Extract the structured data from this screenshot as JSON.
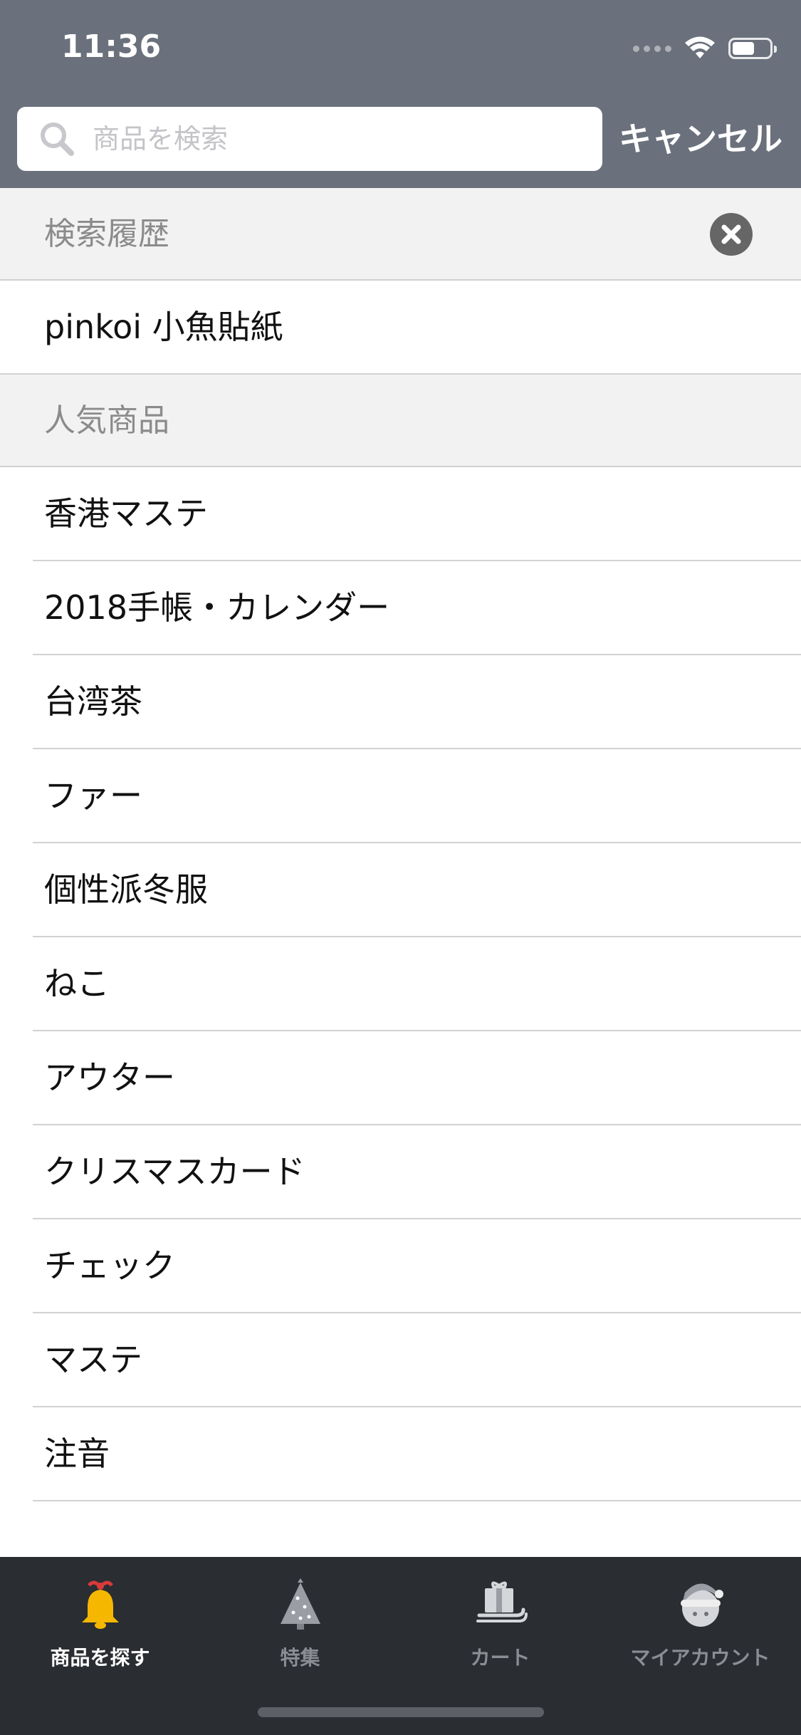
{
  "status_bar": {
    "time": "11:36",
    "battery_level": 0.6
  },
  "search": {
    "placeholder": "商品を検索",
    "value": "",
    "cancel_label": "キャンセル"
  },
  "history": {
    "title": "検索履歴",
    "items": [
      "pinkoi 小魚貼紙"
    ]
  },
  "popular": {
    "title": "人気商品",
    "items": [
      "香港マステ",
      "2018手帳・カレンダー",
      "台湾茶",
      "ファー",
      "個性派冬服",
      "ねこ",
      "アウター",
      "クリスマスカード",
      "チェック",
      "マステ",
      "注音"
    ]
  },
  "tabbar": {
    "tabs": [
      {
        "label": "商品を探す",
        "icon": "bell-icon",
        "active": true
      },
      {
        "label": "特集",
        "icon": "christmas-tree-icon",
        "active": false
      },
      {
        "label": "カート",
        "icon": "sleigh-gift-icon",
        "active": false
      },
      {
        "label": "マイアカウント",
        "icon": "santa-avatar-icon",
        "active": false
      }
    ]
  },
  "colors": {
    "header_bg": "#6a717c",
    "tabbar_bg": "#2a2d31",
    "section_bg": "#f2f2f2",
    "bell_gold": "#f5b700",
    "ribbon_red": "#d83a3a"
  }
}
